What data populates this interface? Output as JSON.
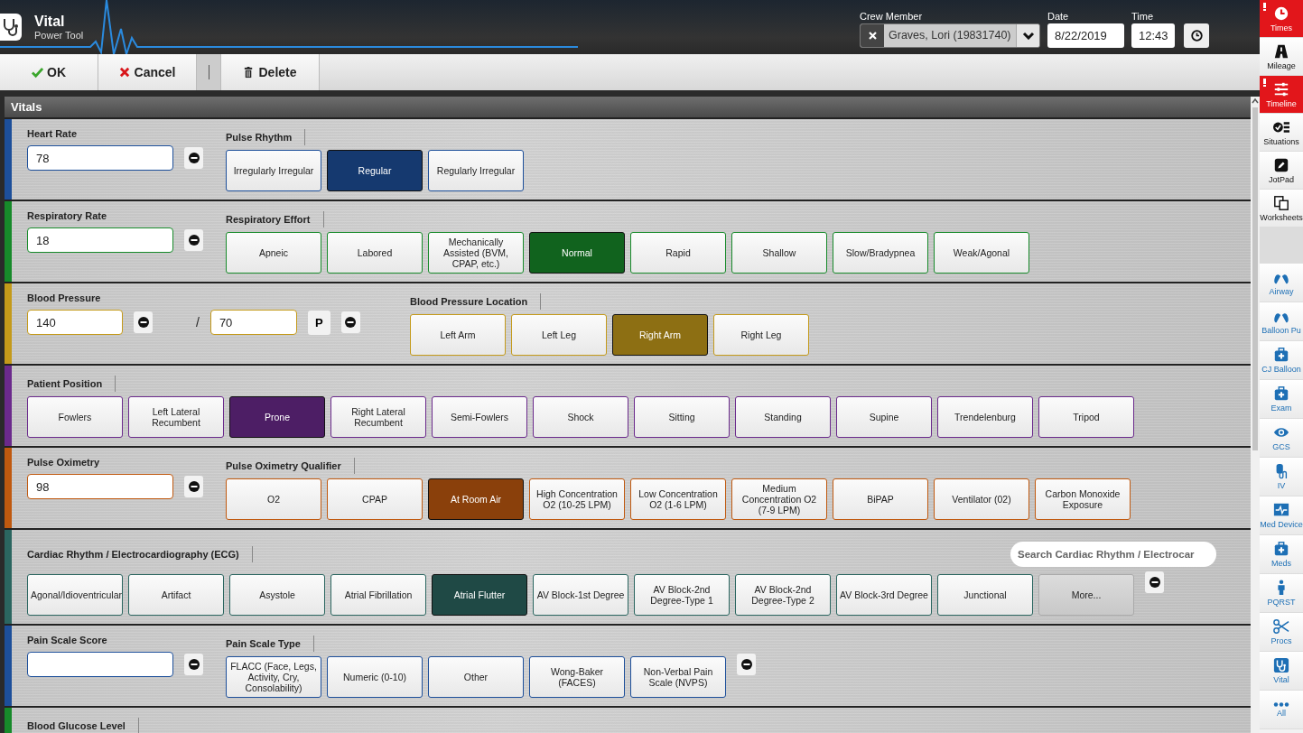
{
  "app": {
    "title": "Vital",
    "subtitle": "Power Tool"
  },
  "header": {
    "crew_label": "Crew Member",
    "crew_value": "Graves, Lori (19831740)",
    "date_label": "Date",
    "date_value": "8/22/2019",
    "time_label": "Time",
    "time_value": "12:43"
  },
  "toolbar": [
    {
      "kind": "ok",
      "label": "OK"
    },
    {
      "kind": "cancel",
      "label": "Cancel"
    },
    {
      "kind": "separator"
    },
    {
      "kind": "delete",
      "label": "Delete"
    }
  ],
  "panel_title": "Vitals",
  "sections": [
    {
      "color": "#1d4f9a",
      "blocks": [
        {
          "kind": "field",
          "label": "Heart Rate",
          "value": "78"
        },
        {
          "kind": "options",
          "label": "Pulse Rhythm",
          "options": [
            {
              "label": "Irregularly Irregular",
              "selected": false
            },
            {
              "label": "Regular",
              "selected": true
            },
            {
              "label": "Regularly Irregular",
              "selected": false
            }
          ]
        }
      ]
    },
    {
      "color": "#178a2a",
      "blocks": [
        {
          "kind": "field",
          "label": "Respiratory Rate",
          "value": "18"
        },
        {
          "kind": "options",
          "label": "Respiratory Effort",
          "options": [
            {
              "label": "Apneic",
              "selected": false
            },
            {
              "label": "Labored",
              "selected": false
            },
            {
              "label": "Mechanically Assisted (BVM, CPAP, etc.)",
              "selected": false
            },
            {
              "label": "Normal",
              "selected": true
            },
            {
              "label": "Rapid",
              "selected": false
            },
            {
              "label": "Shallow",
              "selected": false
            },
            {
              "label": "Slow/Bradypnea",
              "selected": false
            },
            {
              "label": "Weak/Agonal",
              "selected": false
            }
          ]
        }
      ]
    },
    {
      "color": "#c49a1a",
      "blocks": [
        {
          "kind": "bp",
          "label": "Blood Pressure",
          "systolic": "140",
          "separator": "/",
          "diastolic": "70",
          "mode": "P"
        },
        {
          "kind": "options",
          "label": "Blood Pressure Location",
          "options": [
            {
              "label": "Left Arm",
              "selected": false
            },
            {
              "label": "Left Leg",
              "selected": false
            },
            {
              "label": "Right Arm",
              "selected": true
            },
            {
              "label": "Right Leg",
              "selected": false
            }
          ]
        }
      ]
    },
    {
      "color": "#6b2a8c",
      "blocks": [
        {
          "kind": "options",
          "label": "Patient Position",
          "options": [
            {
              "label": "Fowlers",
              "selected": false
            },
            {
              "label": "Left Lateral Recumbent",
              "selected": false
            },
            {
              "label": "Prone",
              "selected": true
            },
            {
              "label": "Right Lateral Recumbent",
              "selected": false
            },
            {
              "label": "Semi-Fowlers",
              "selected": false
            },
            {
              "label": "Shock",
              "selected": false
            },
            {
              "label": "Sitting",
              "selected": false
            },
            {
              "label": "Standing",
              "selected": false
            },
            {
              "label": "Supine",
              "selected": false
            },
            {
              "label": "Trendelenburg",
              "selected": false
            },
            {
              "label": "Tripod",
              "selected": false
            }
          ]
        }
      ]
    },
    {
      "color": "#c0590f",
      "blocks": [
        {
          "kind": "field",
          "label": "Pulse Oximetry",
          "value": "98"
        },
        {
          "kind": "options",
          "label": "Pulse Oximetry Qualifier",
          "options": [
            {
              "label": "O2",
              "selected": false
            },
            {
              "label": "CPAP",
              "selected": false
            },
            {
              "label": "At Room Air",
              "selected": true
            },
            {
              "label": "High Concentration O2 (10-25 LPM)",
              "selected": false
            },
            {
              "label": "Low Concentration O2 (1-6 LPM)",
              "selected": false
            },
            {
              "label": "Medium Concentration O2 (7-9 LPM)",
              "selected": false
            },
            {
              "label": "BiPAP",
              "selected": false
            },
            {
              "label": "Ventilator (02)",
              "selected": false
            },
            {
              "label": "Carbon Monoxide Exposure",
              "selected": false
            }
          ]
        }
      ]
    },
    {
      "color": "#2b6660",
      "blocks": [
        {
          "kind": "options",
          "label": "Cardiac Rhythm / Electrocardiography (ECG)",
          "search": {
            "placeholder": "Search Cardiac Rhythm / Electrocar"
          },
          "more": "More...",
          "clear": true,
          "options": [
            {
              "label": "Agonal/Idioventricular",
              "selected": false
            },
            {
              "label": "Artifact",
              "selected": false
            },
            {
              "label": "Asystole",
              "selected": false
            },
            {
              "label": "Atrial Fibrillation",
              "selected": false
            },
            {
              "label": "Atrial Flutter",
              "selected": true
            },
            {
              "label": "AV Block-1st Degree",
              "selected": false
            },
            {
              "label": "AV Block-2nd Degree-Type 1",
              "selected": false
            },
            {
              "label": "AV Block-2nd Degree-Type 2",
              "selected": false
            },
            {
              "label": "AV Block-3rd Degree",
              "selected": false
            },
            {
              "label": "Junctional",
              "selected": false
            }
          ]
        }
      ]
    },
    {
      "color": "#1d4f9a",
      "blocks": [
        {
          "kind": "field",
          "label": "Pain Scale Score"
        },
        {
          "kind": "options",
          "label": "Pain Scale Type",
          "clear": true,
          "options": [
            {
              "label": "FLACC (Face, Legs, Activity, Cry, Consolability)",
              "selected": false
            },
            {
              "label": "Numeric (0-10)",
              "selected": false
            },
            {
              "label": "Other",
              "selected": false
            },
            {
              "label": "Wong-Baker (FACES)",
              "selected": false
            },
            {
              "label": "Non-Verbal Pain Scale (NVPS)",
              "selected": false
            }
          ]
        }
      ]
    },
    {
      "color": "#178a2a",
      "blocks": [
        {
          "kind": "heading",
          "label": "Blood Glucose Level"
        }
      ]
    }
  ],
  "sidebar": [
    {
      "kind": "tool",
      "label": "Times",
      "alert": true
    },
    {
      "kind": "tool",
      "label": "Mileage",
      "alert": false
    },
    {
      "kind": "tool",
      "label": "Timeline",
      "alert": true
    },
    {
      "kind": "tool",
      "label": "Situations",
      "alert": false
    },
    {
      "kind": "tool",
      "label": "JotPad",
      "alert": false
    },
    {
      "kind": "tool",
      "label": "Worksheets",
      "alert": false
    },
    {
      "kind": "form",
      "label": "Airway",
      "alert": false
    },
    {
      "kind": "form",
      "label": "Balloon Pu",
      "alert": false
    },
    {
      "kind": "form",
      "label": "CJ Balloon",
      "alert": false
    },
    {
      "kind": "form",
      "label": "Exam",
      "alert": false
    },
    {
      "kind": "form",
      "label": "GCS",
      "alert": false
    },
    {
      "kind": "form",
      "label": "IV",
      "alert": false
    },
    {
      "kind": "form",
      "label": "Med Device",
      "alert": false
    },
    {
      "kind": "form",
      "label": "Meds",
      "alert": false
    },
    {
      "kind": "form",
      "label": "PQRST",
      "alert": false
    },
    {
      "kind": "form",
      "label": "Procs",
      "alert": false
    },
    {
      "kind": "form",
      "label": "Vital",
      "alert": false
    },
    {
      "kind": "form",
      "label": "All",
      "alert": false
    }
  ]
}
